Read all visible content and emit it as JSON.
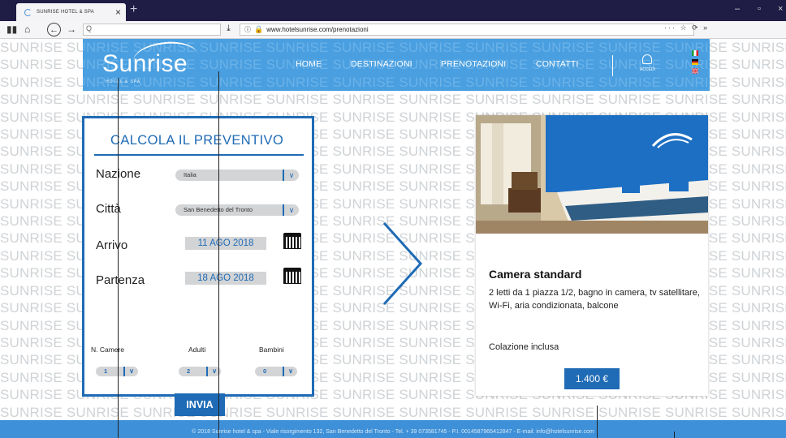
{
  "browser": {
    "tab_title": "SUNRISE HOTEL & SPA",
    "tab_close": "×",
    "new_tab": "+",
    "window_controls": [
      "–",
      "▫",
      "×"
    ],
    "search_placeholder": "Q",
    "url": "www.hotelsunrise.com/prenotazioni",
    "url_right_icons": "··· ☆ ⟳ »"
  },
  "background_word": "SUNRISE",
  "header": {
    "logo": "Sunrise",
    "logo_sub": "HOTEL & SPA",
    "menu": [
      "HOME",
      "DESTINAZIONI",
      "PRENOTAZIONI",
      "CONTATTI"
    ],
    "login_label": "ACCEDI",
    "languages": [
      "italian-flag",
      "german-flag",
      "uk-flag"
    ]
  },
  "form": {
    "title": "CALCOLA IL PREVENTIVO",
    "nation_label": "Nazione",
    "nation_value": "Italia",
    "city_label": "Città",
    "city_value": "San Benedetto del Tronto",
    "arrival_label": "Arrivo",
    "arrival_value": "11 AGO 2018",
    "departure_label": "Partenza",
    "departure_value": "18 AGO 2018",
    "rooms_label": "N. Camere",
    "rooms_value": "1",
    "adults_label": "Adulti",
    "adults_value": "2",
    "children_label": "Bambini",
    "children_value": "0",
    "submit_label": "INVIA"
  },
  "room": {
    "title": "Camera standard",
    "description": "2 letti da 1 piazza 1/2, bagno in camera, tv satellitare, Wi-Fi, aria condizionata, balcone",
    "extra": "Colazione inclusa",
    "price": "1.400 €"
  },
  "footer": {
    "text": "© 2018 Sunrise hotel & spa - Viale risorgimento 132, San Benedetto del Tronto - Tel. + 39 073581745 - P.I. 0014587965412847 - E-mail: info@hotelsunrise.com"
  },
  "colors": {
    "brand_blue": "#1f6bb5",
    "header_blue": "#4a9fe0",
    "footer_blue": "#3e90d8"
  }
}
